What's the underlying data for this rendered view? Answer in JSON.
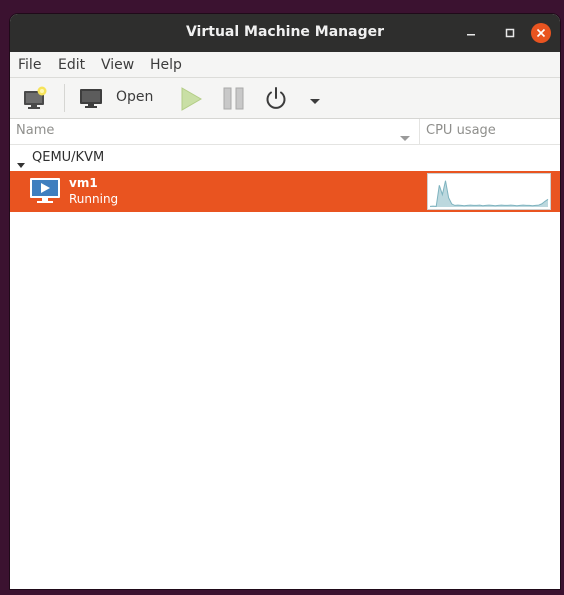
{
  "window": {
    "title": "Virtual Machine Manager",
    "controls": {
      "minimize": "minimize-icon",
      "maximize": "maximize-icon",
      "close": "close-icon"
    }
  },
  "menu": {
    "items": [
      {
        "label": "File"
      },
      {
        "label": "Edit"
      },
      {
        "label": "View"
      },
      {
        "label": "Help"
      }
    ]
  },
  "toolbar": {
    "new_vm": "new-vm-icon",
    "open_label": "Open",
    "run": "run-icon",
    "pause": "pause-icon",
    "shutdown": "power-icon",
    "more": "chevron-down-icon"
  },
  "columns": {
    "name": "Name",
    "cpu": "CPU usage"
  },
  "connection": {
    "label": "QEMU/KVM"
  },
  "vms": [
    {
      "name": "vm1",
      "state": "Running",
      "cpu_usage_history": [
        0.02,
        0.03,
        0.02,
        0.7,
        0.4,
        0.85,
        0.3,
        0.1,
        0.05,
        0.06,
        0.05,
        0.04,
        0.05,
        0.06,
        0.05,
        0.05,
        0.06,
        0.04,
        0.05,
        0.06,
        0.05,
        0.04,
        0.05,
        0.06,
        0.05,
        0.05,
        0.06,
        0.05,
        0.04,
        0.05,
        0.06,
        0.05,
        0.05,
        0.04,
        0.05,
        0.06,
        0.1,
        0.18,
        0.25
      ]
    }
  ],
  "colors": {
    "selection": "#e95420",
    "titlebar": "#2e2e2d",
    "close_button": "#e95420",
    "graph_line": "#7eb3bf",
    "graph_fill": "#bcd8de"
  }
}
